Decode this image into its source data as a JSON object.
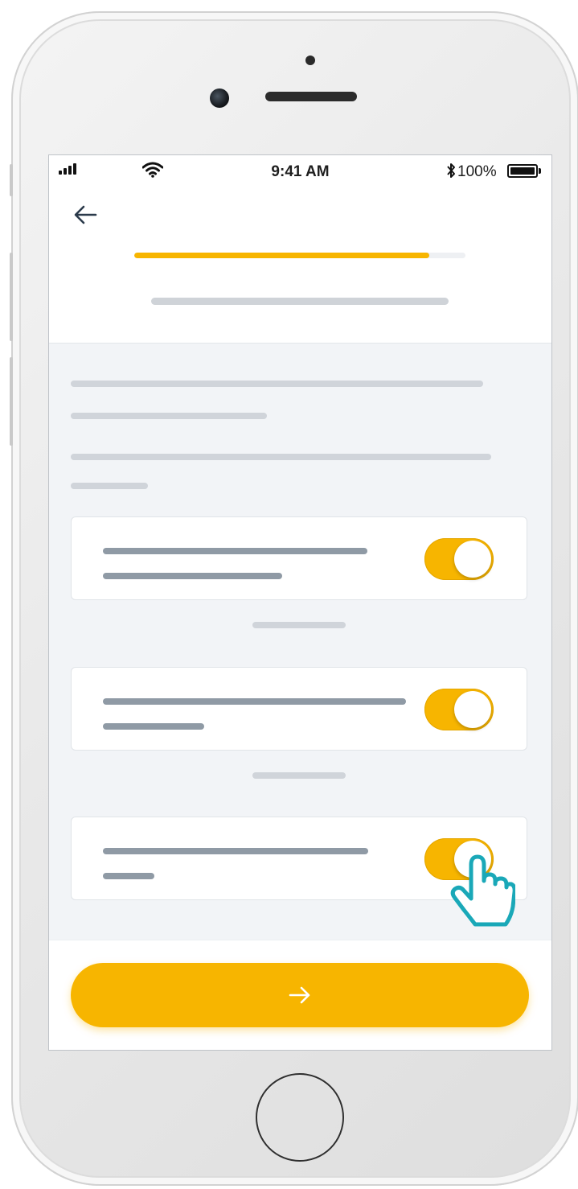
{
  "status_bar": {
    "time": "9:41 AM",
    "battery_percent": "100%",
    "signal_icon": "signal-bars-icon",
    "wifi_icon": "wifi-icon",
    "bluetooth_icon": "bluetooth-icon"
  },
  "header": {
    "back_icon": "arrow-left-icon",
    "progress_fraction": 0.89
  },
  "settings": [
    {
      "name": "setting-1",
      "enabled": true
    },
    {
      "name": "setting-2",
      "enabled": true
    },
    {
      "name": "setting-3",
      "enabled": true
    }
  ],
  "footer": {
    "next_icon": "arrow-right-icon"
  },
  "colors": {
    "accent": "#f7b500",
    "pointer_cursor": "#1aa8b8",
    "placeholder_dark": "#8f9aa5",
    "placeholder_light": "#d0d4da",
    "screen_background": "#f2f4f7"
  }
}
